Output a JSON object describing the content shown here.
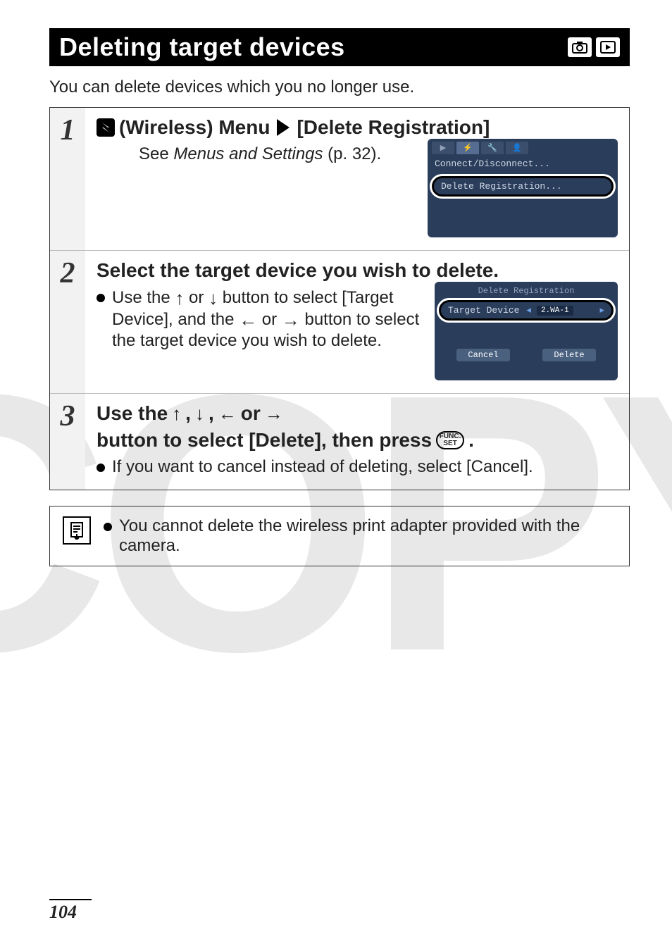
{
  "title": "Deleting target devices",
  "intro": "You can delete devices which you no longer use.",
  "steps": {
    "s1": {
      "num": "1",
      "title_pre": "(Wireless) Menu",
      "title_post": "[Delete Registration]",
      "sub_pre": "See ",
      "sub_em": "Menus and Settings",
      "sub_post": " (p. 32).",
      "scr": {
        "row1": "Connect/Disconnect...",
        "row2": "Delete Registration..."
      }
    },
    "s2": {
      "num": "2",
      "title": "Select the target device you wish to delete.",
      "bullet": "Use the  ↑  or  ↓  button to select [Target Device], and the  ←  or  →  button to select the target device you wish to delete.",
      "bullet_text_a": "Use the ",
      "bullet_text_b": " or ",
      "bullet_text_c": " button to select [Target Device], and the ",
      "bullet_text_d": " or ",
      "bullet_text_e": " button to select the target device you wish to delete.",
      "scr": {
        "header": "Delete Registration",
        "label": "Target Device",
        "value": "2.WA-1",
        "cancel": "Cancel",
        "delete": "Delete"
      }
    },
    "s3": {
      "num": "3",
      "title_a": "Use the ",
      "title_b": ", ",
      "title_c": ", ",
      "title_d": " or ",
      "title_e": " button to select [Delete], then press ",
      "title_f": ".",
      "bullet": "If you want to cancel instead of deleting, select [Cancel]."
    }
  },
  "note": "You cannot delete the wireless print adapter provided with the camera.",
  "func_top": "FUNC.",
  "func_bot": "SET",
  "page_number": "104"
}
